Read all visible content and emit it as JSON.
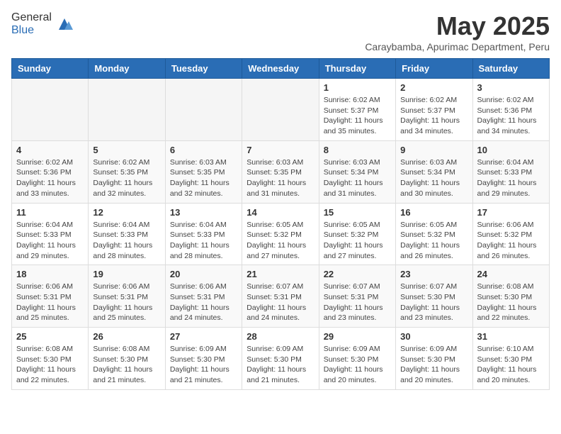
{
  "logo": {
    "general": "General",
    "blue": "Blue"
  },
  "header": {
    "month": "May 2025",
    "location": "Caraybamba, Apurimac Department, Peru"
  },
  "weekdays": [
    "Sunday",
    "Monday",
    "Tuesday",
    "Wednesday",
    "Thursday",
    "Friday",
    "Saturday"
  ],
  "weeks": [
    [
      {
        "day": "",
        "info": ""
      },
      {
        "day": "",
        "info": ""
      },
      {
        "day": "",
        "info": ""
      },
      {
        "day": "",
        "info": ""
      },
      {
        "day": "1",
        "info": "Sunrise: 6:02 AM\nSunset: 5:37 PM\nDaylight: 11 hours and 35 minutes."
      },
      {
        "day": "2",
        "info": "Sunrise: 6:02 AM\nSunset: 5:37 PM\nDaylight: 11 hours and 34 minutes."
      },
      {
        "day": "3",
        "info": "Sunrise: 6:02 AM\nSunset: 5:36 PM\nDaylight: 11 hours and 34 minutes."
      }
    ],
    [
      {
        "day": "4",
        "info": "Sunrise: 6:02 AM\nSunset: 5:36 PM\nDaylight: 11 hours and 33 minutes."
      },
      {
        "day": "5",
        "info": "Sunrise: 6:02 AM\nSunset: 5:35 PM\nDaylight: 11 hours and 32 minutes."
      },
      {
        "day": "6",
        "info": "Sunrise: 6:03 AM\nSunset: 5:35 PM\nDaylight: 11 hours and 32 minutes."
      },
      {
        "day": "7",
        "info": "Sunrise: 6:03 AM\nSunset: 5:35 PM\nDaylight: 11 hours and 31 minutes."
      },
      {
        "day": "8",
        "info": "Sunrise: 6:03 AM\nSunset: 5:34 PM\nDaylight: 11 hours and 31 minutes."
      },
      {
        "day": "9",
        "info": "Sunrise: 6:03 AM\nSunset: 5:34 PM\nDaylight: 11 hours and 30 minutes."
      },
      {
        "day": "10",
        "info": "Sunrise: 6:04 AM\nSunset: 5:33 PM\nDaylight: 11 hours and 29 minutes."
      }
    ],
    [
      {
        "day": "11",
        "info": "Sunrise: 6:04 AM\nSunset: 5:33 PM\nDaylight: 11 hours and 29 minutes."
      },
      {
        "day": "12",
        "info": "Sunrise: 6:04 AM\nSunset: 5:33 PM\nDaylight: 11 hours and 28 minutes."
      },
      {
        "day": "13",
        "info": "Sunrise: 6:04 AM\nSunset: 5:33 PM\nDaylight: 11 hours and 28 minutes."
      },
      {
        "day": "14",
        "info": "Sunrise: 6:05 AM\nSunset: 5:32 PM\nDaylight: 11 hours and 27 minutes."
      },
      {
        "day": "15",
        "info": "Sunrise: 6:05 AM\nSunset: 5:32 PM\nDaylight: 11 hours and 27 minutes."
      },
      {
        "day": "16",
        "info": "Sunrise: 6:05 AM\nSunset: 5:32 PM\nDaylight: 11 hours and 26 minutes."
      },
      {
        "day": "17",
        "info": "Sunrise: 6:06 AM\nSunset: 5:32 PM\nDaylight: 11 hours and 26 minutes."
      }
    ],
    [
      {
        "day": "18",
        "info": "Sunrise: 6:06 AM\nSunset: 5:31 PM\nDaylight: 11 hours and 25 minutes."
      },
      {
        "day": "19",
        "info": "Sunrise: 6:06 AM\nSunset: 5:31 PM\nDaylight: 11 hours and 25 minutes."
      },
      {
        "day": "20",
        "info": "Sunrise: 6:06 AM\nSunset: 5:31 PM\nDaylight: 11 hours and 24 minutes."
      },
      {
        "day": "21",
        "info": "Sunrise: 6:07 AM\nSunset: 5:31 PM\nDaylight: 11 hours and 24 minutes."
      },
      {
        "day": "22",
        "info": "Sunrise: 6:07 AM\nSunset: 5:31 PM\nDaylight: 11 hours and 23 minutes."
      },
      {
        "day": "23",
        "info": "Sunrise: 6:07 AM\nSunset: 5:30 PM\nDaylight: 11 hours and 23 minutes."
      },
      {
        "day": "24",
        "info": "Sunrise: 6:08 AM\nSunset: 5:30 PM\nDaylight: 11 hours and 22 minutes."
      }
    ],
    [
      {
        "day": "25",
        "info": "Sunrise: 6:08 AM\nSunset: 5:30 PM\nDaylight: 11 hours and 22 minutes."
      },
      {
        "day": "26",
        "info": "Sunrise: 6:08 AM\nSunset: 5:30 PM\nDaylight: 11 hours and 21 minutes."
      },
      {
        "day": "27",
        "info": "Sunrise: 6:09 AM\nSunset: 5:30 PM\nDaylight: 11 hours and 21 minutes."
      },
      {
        "day": "28",
        "info": "Sunrise: 6:09 AM\nSunset: 5:30 PM\nDaylight: 11 hours and 21 minutes."
      },
      {
        "day": "29",
        "info": "Sunrise: 6:09 AM\nSunset: 5:30 PM\nDaylight: 11 hours and 20 minutes."
      },
      {
        "day": "30",
        "info": "Sunrise: 6:09 AM\nSunset: 5:30 PM\nDaylight: 11 hours and 20 minutes."
      },
      {
        "day": "31",
        "info": "Sunrise: 6:10 AM\nSunset: 5:30 PM\nDaylight: 11 hours and 20 minutes."
      }
    ]
  ]
}
